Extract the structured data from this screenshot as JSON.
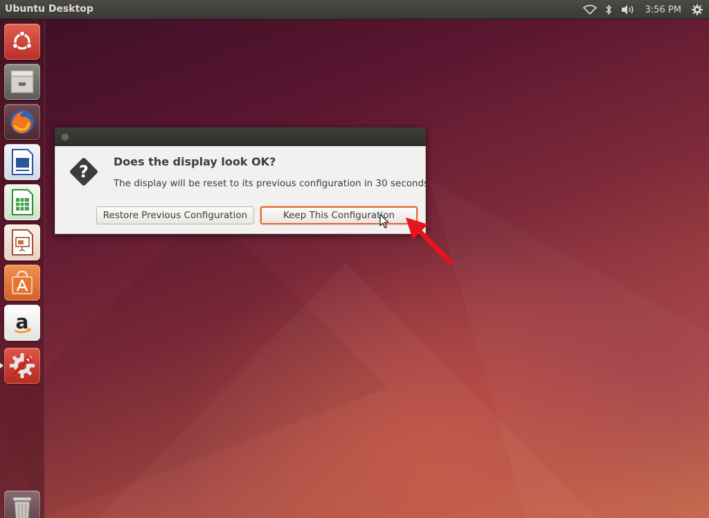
{
  "top_panel": {
    "title": "Ubuntu Desktop",
    "clock": "3:56 PM",
    "indicators": [
      "wifi-icon",
      "bluetooth-icon",
      "volume-icon",
      "gear-icon"
    ]
  },
  "launcher": {
    "items": [
      {
        "name": "ubuntu-dash",
        "icon": "ubuntu-logo-icon"
      },
      {
        "name": "files",
        "icon": "file-cabinet-icon"
      },
      {
        "name": "firefox",
        "icon": "firefox-icon"
      },
      {
        "name": "libreoffice-writer",
        "icon": "writer-document-icon"
      },
      {
        "name": "libreoffice-calc",
        "icon": "calc-spreadsheet-icon"
      },
      {
        "name": "libreoffice-impress",
        "icon": "impress-presentation-icon"
      },
      {
        "name": "software-center",
        "icon": "shopping-bag-icon"
      },
      {
        "name": "amazon",
        "icon": "amazon-icon"
      },
      {
        "name": "system-settings",
        "icon": "settings-wrench-gear-icon",
        "running": true
      },
      {
        "name": "trash",
        "icon": "trash-icon"
      }
    ]
  },
  "dialog": {
    "heading": "Does the display look OK?",
    "message": "The display will be reset to its previous configuration in 30 seconds",
    "restore_label": "Restore Previous Configuration",
    "keep_label": "Keep This Configuration",
    "focused_button": "keep"
  },
  "colors": {
    "panel": "#3c3b37",
    "dialog_bg": "#f2f1f0",
    "focus_ring": "#e66a38",
    "annotation_arrow": "#e8141c"
  }
}
